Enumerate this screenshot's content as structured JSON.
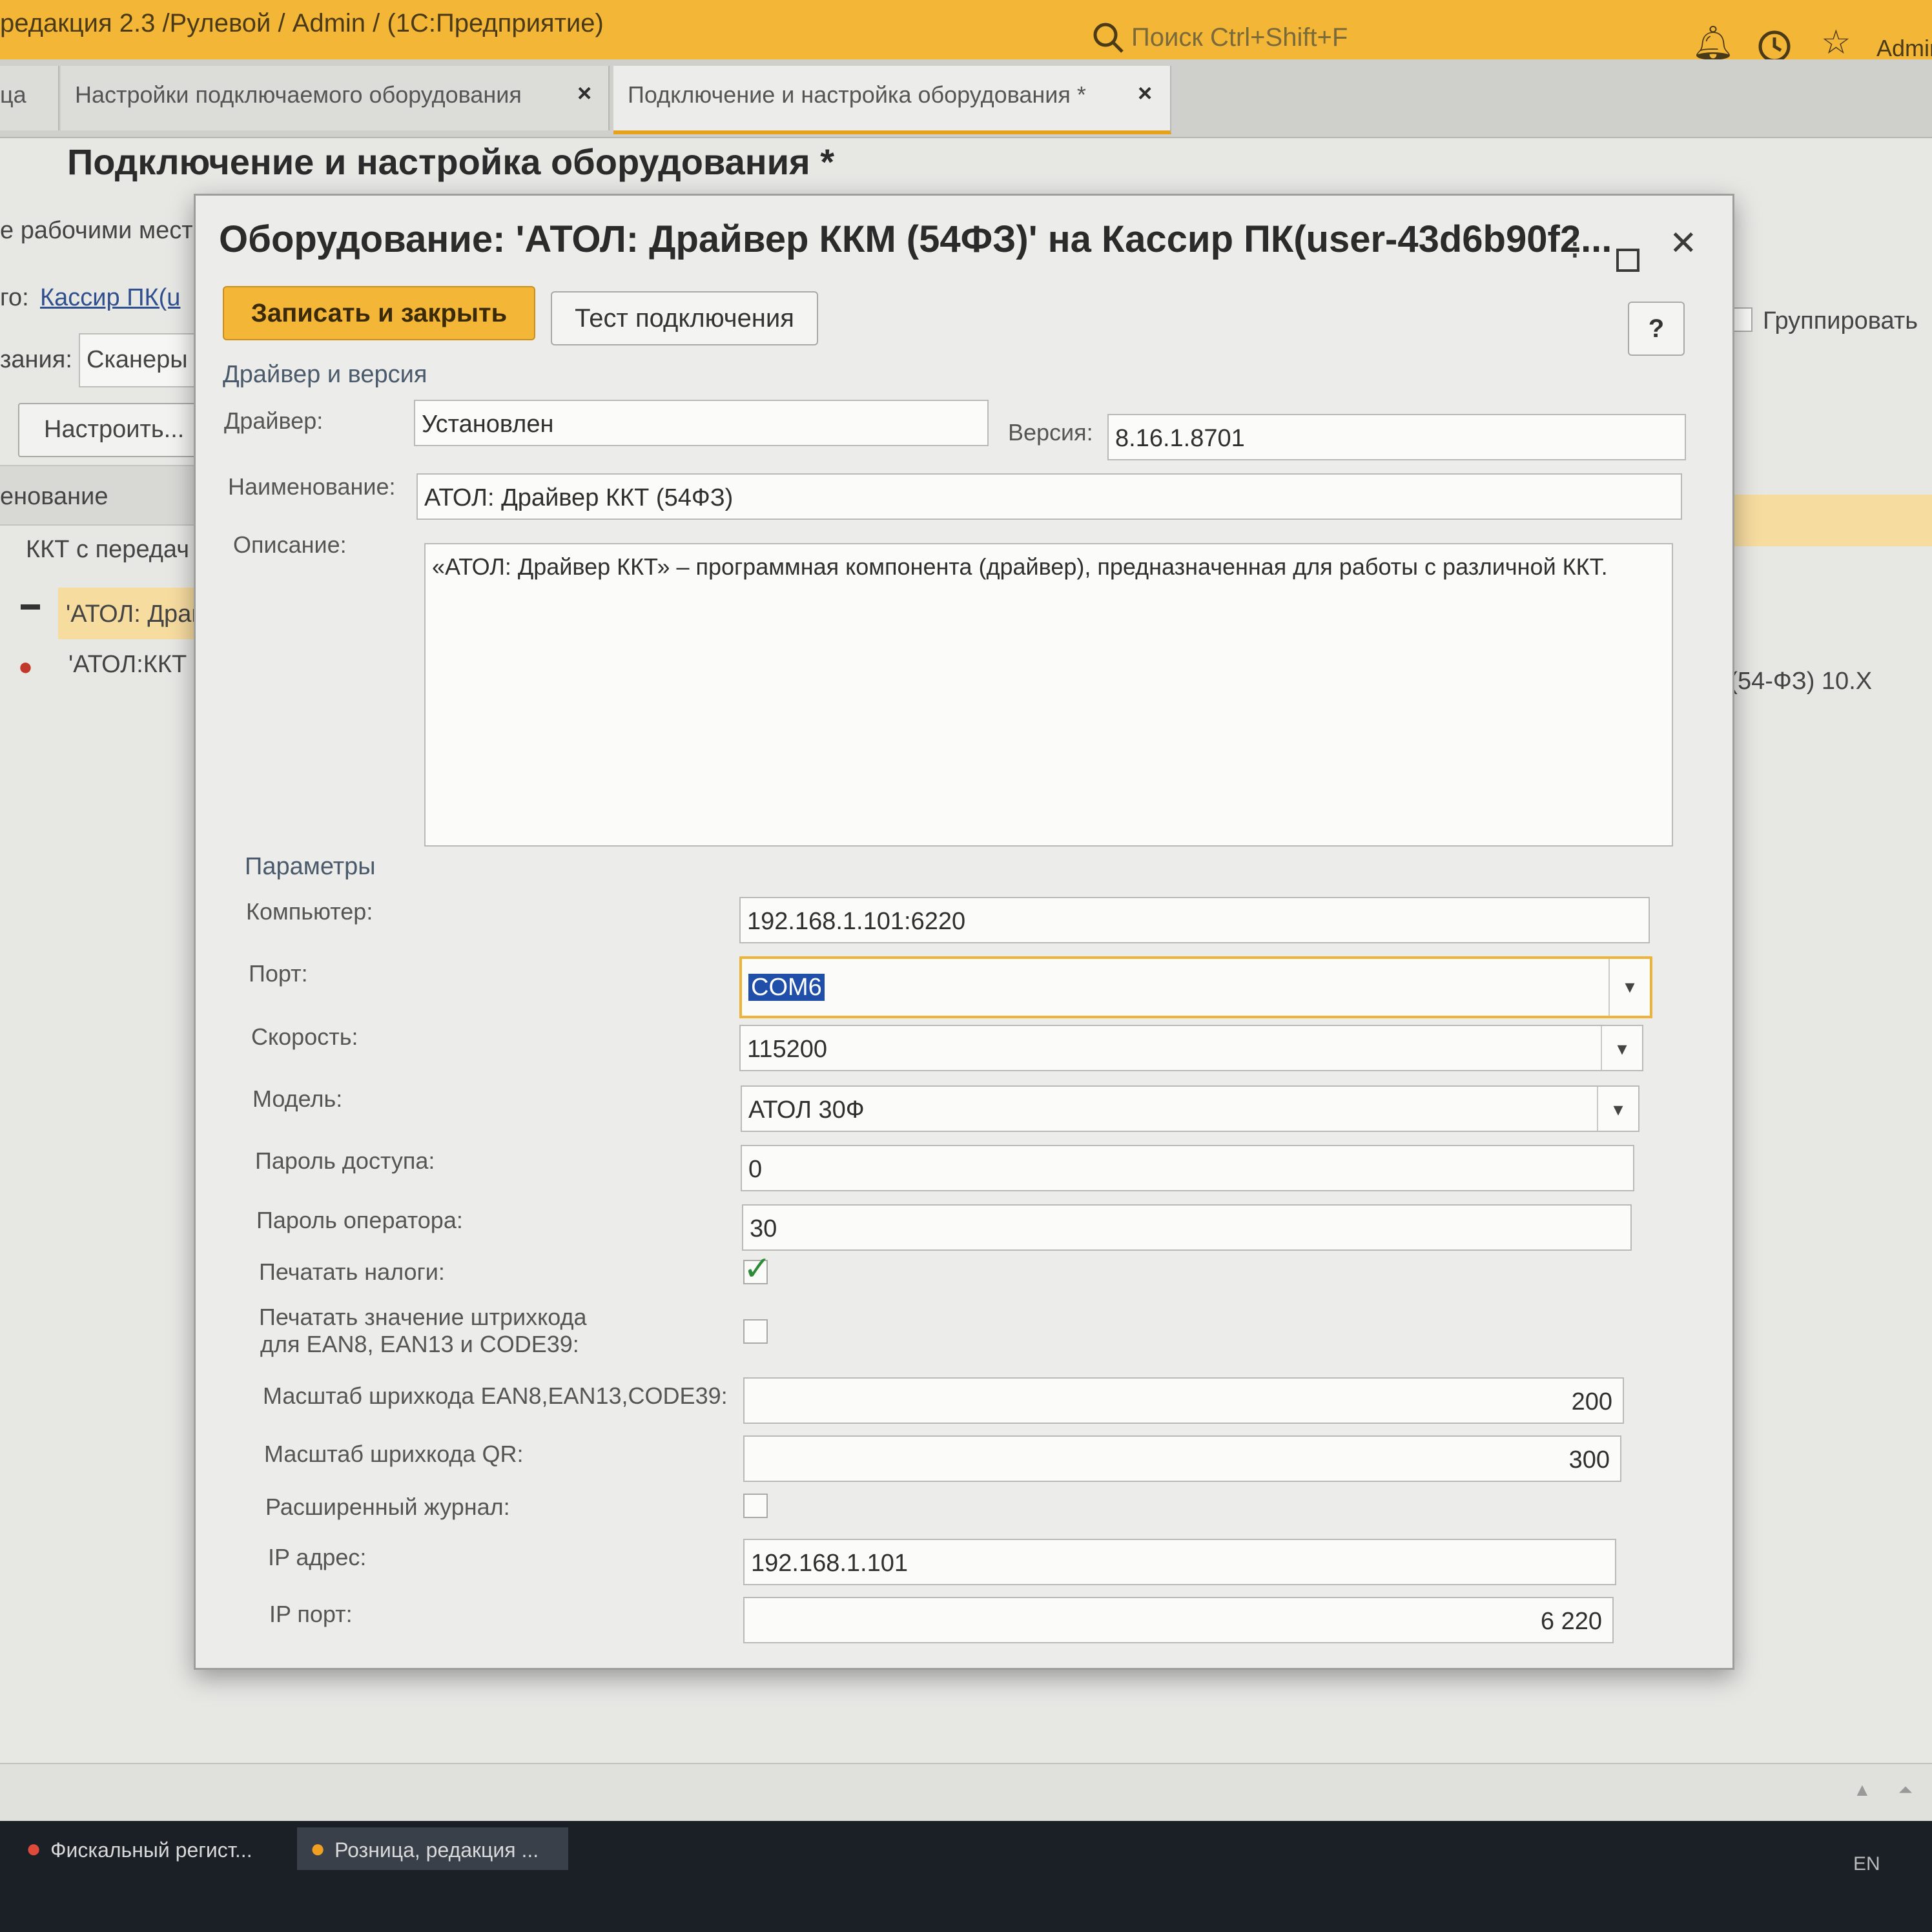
{
  "app": {
    "window_title": "редакция 2.3 /Рулевой / Admin /  (1С:Предприятие)",
    "search_placeholder": "Поиск Ctrl+Shift+F",
    "user": "Admin"
  },
  "tabs": [
    {
      "label": "ца"
    },
    {
      "label": "Настройки подключаемого оборудования",
      "close": "×"
    },
    {
      "label": "Подключение и настройка оборудования *",
      "close": "×"
    }
  ],
  "page": {
    "title": "Подключение и настройка оборудования *"
  },
  "background_left": {
    "line1": "е рабочими мест",
    "line2_label": "го:",
    "line2_link": "Кассир ПК(u",
    "line3_label": "зания:",
    "line3_value": "Сканеры",
    "configure_button": "Настроить...",
    "column_header": "енование",
    "row1": "ККТ с передач",
    "row2": "'АТОЛ: Драй",
    "row3": "'АТОЛ:ККТ с"
  },
  "background_right": {
    "group_label": "Группировать",
    "row_text": "Д (54-ФЗ) 10.X"
  },
  "modal": {
    "title": "Оборудование: 'АТОЛ: Драйвер ККМ (54ФЗ)' на Кассир ПК(user-43d6b90f2...",
    "save_close_button": "Записать и закрыть",
    "test_button": "Тест подключения",
    "help_button": "?",
    "section_driver": "Драйвер и версия",
    "driver_label": "Драйвер:",
    "driver_value": "Установлен",
    "version_label": "Версия:",
    "version_value": "8.16.1.8701",
    "name_label": "Наименование:",
    "name_value": "АТОЛ: Драйвер ККТ (54ФЗ)",
    "description_label": "Описание:",
    "description_value": "«АТОЛ: Драйвер ККТ» – программная компонента (драйвер), предназначенная для работы с различной ККТ.",
    "section_params": "Параметры",
    "computer_label": "Компьютер:",
    "computer_value": "192.168.1.101:6220",
    "port_label": "Порт:",
    "port_value": "COM6",
    "speed_label": "Скорость:",
    "speed_value": "115200",
    "model_label": "Модель:",
    "model_value": "АТОЛ 30Ф",
    "access_password_label": "Пароль доступа:",
    "access_password_value": "0",
    "operator_password_label": "Пароль оператора:",
    "operator_password_value": "30",
    "print_taxes_label": "Печатать налоги:",
    "print_taxes_checked": true,
    "print_barcode_label_1": "Печатать значение штрихкода",
    "print_barcode_label_2": "для EAN8, EAN13 и CODE39:",
    "print_barcode_checked": false,
    "barcode_scale_label": "Масштаб шрихкода EAN8,EAN13,CODE39:",
    "barcode_scale_value": "200",
    "qr_scale_label": "Масштаб шрихкода QR:",
    "qr_scale_value": "300",
    "extended_log_label": "Расширенный журнал:",
    "extended_log_checked": false,
    "ip_address_label": "IP адрес:",
    "ip_address_value": "192.168.1.101",
    "ip_port_label": "IP порт:",
    "ip_port_value": "6 220"
  },
  "taskbar": {
    "item1": "Фискальный регист...",
    "item2": "Розница, редакция ...",
    "lang": "EN"
  },
  "colors": {
    "accent": "#f3b637",
    "focus_border": "#f0b33a",
    "selection": "#1f4fa8",
    "check": "#2e8b3a"
  }
}
